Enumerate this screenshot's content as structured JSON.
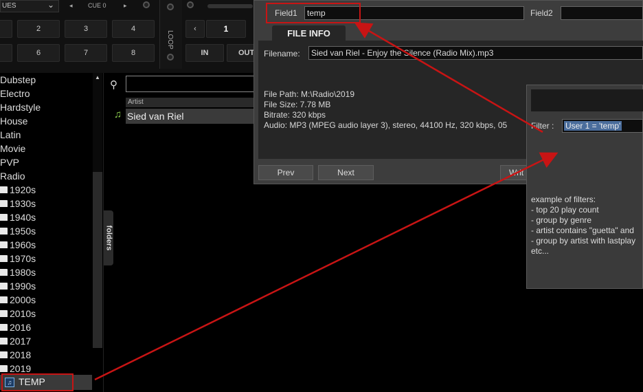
{
  "deck": {
    "dropdown_label": "UES",
    "cue_label": "CUE 0",
    "pads": [
      "2",
      "3",
      "4",
      "6",
      "7",
      "8"
    ],
    "loop_label": "LOOP",
    "loop_number": "1",
    "in_label": "IN",
    "out_label": "OUT"
  },
  "sidebar": {
    "items": [
      "Dubstep",
      "Electro",
      "Hardstyle",
      "House",
      "Latin",
      "Movie",
      "PVP",
      "Radio"
    ],
    "subfolders": [
      "1920s",
      "1930s",
      "1940s",
      "1950s",
      "1960s",
      "1970s",
      "1980s",
      "1990s",
      "2000s",
      "2010s",
      "2016",
      "2017",
      "2018",
      "2019"
    ],
    "filter_folder": "TEMP",
    "folders_tab": "folders"
  },
  "browser": {
    "column_artist": "Artist",
    "track_artist": "Sied van Riel"
  },
  "fileinfo": {
    "field1_label": "Field1",
    "field1_value": "temp",
    "field2_label": "Field2",
    "field2_value": "",
    "tab_label": "FILE INFO",
    "filename_label": "Filename:",
    "filename_value": "Sied van Riel - Enjoy the Silence (Radio Mix).mp3",
    "file_path": "File Path: M:\\Radio\\2019",
    "file_size": "File Size: 7.78 MB",
    "bitrate": "Bitrate: 320 kbps",
    "audio": "Audio: MP3 (MPEG audio layer 3), stereo, 44100 Hz, 320 kbps, 05",
    "prev_label": "Prev",
    "next_label": "Next",
    "write_label": "Writ"
  },
  "filter": {
    "filter_label": "Filter :",
    "filter_value": "User 1 = 'temp'",
    "help_title": "example of filters:",
    "help_lines": [
      "- top 20 play count",
      "- group by genre",
      "- artist contains \"guetta\" and",
      "- group by artist with lastplay",
      "etc..."
    ]
  },
  "colors": {
    "annotation_red": "#c81414",
    "selection_blue": "#4a6d9c"
  }
}
